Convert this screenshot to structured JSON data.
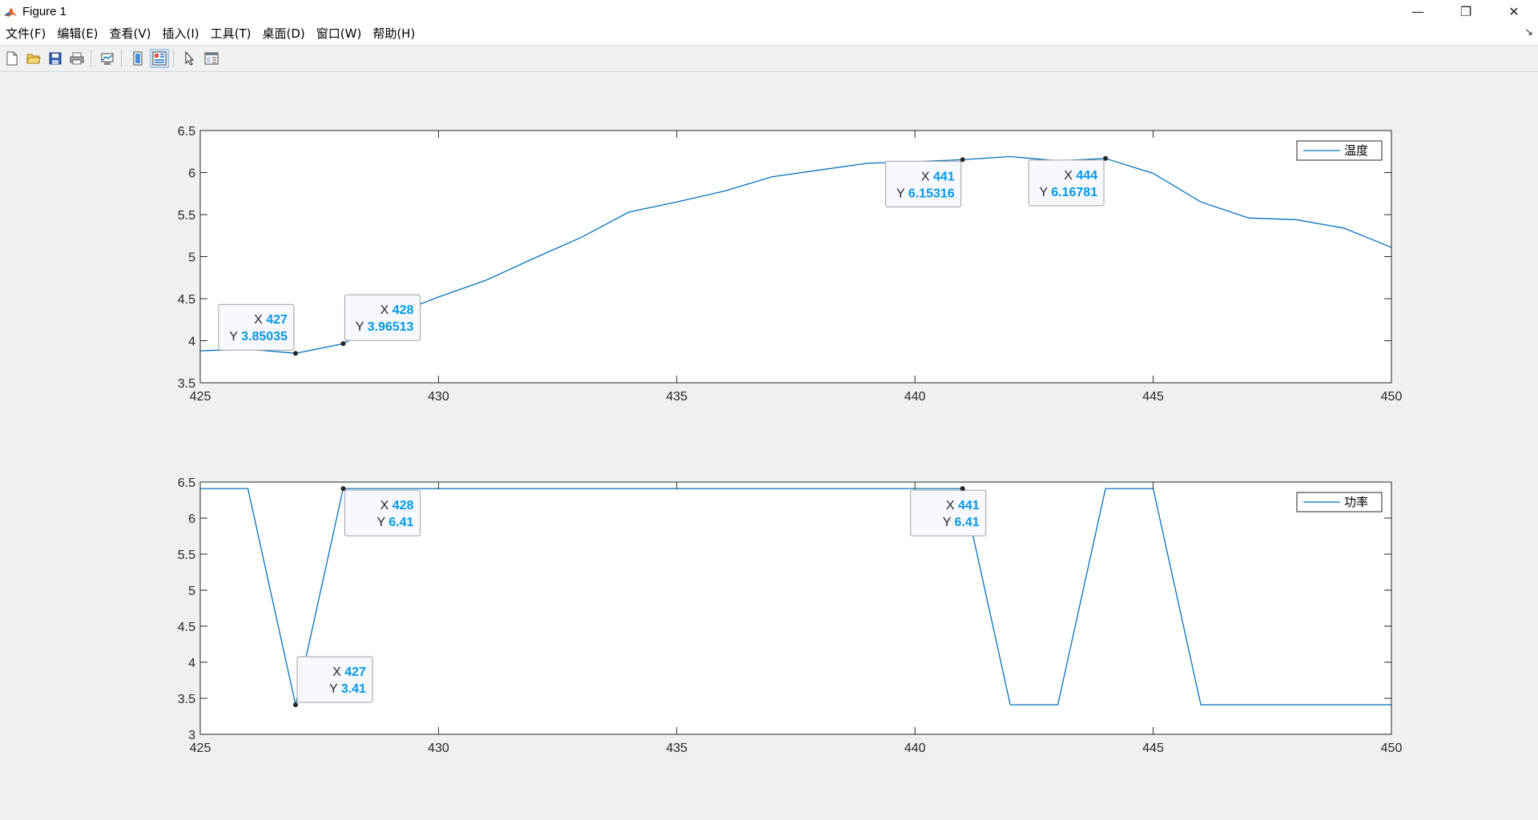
{
  "window": {
    "title": "Figure 1",
    "minimize_glyph": "—",
    "restore_glyph": "❐",
    "close_glyph": "✕"
  },
  "menu": {
    "items": [
      "文件(F)",
      "编辑(E)",
      "查看(V)",
      "插入(I)",
      "工具(T)",
      "桌面(D)",
      "窗口(W)",
      "帮助(H)"
    ],
    "dock_glyph": "↘"
  },
  "toolbar": {
    "icons": [
      "new-figure-icon",
      "open-file-icon",
      "save-icon",
      "print-icon",
      "link-plot-icon",
      "hide-plot-tools-icon",
      "show-plot-tools-icon",
      "edit-plot-pointer-icon",
      "property-inspector-icon"
    ]
  },
  "colors": {
    "line": "#0072bd",
    "datatip_value": "#0099e6",
    "axes_bg": "#ffffff",
    "figure_bg": "#f0f0f0"
  },
  "chart_data": [
    {
      "type": "line",
      "title": "",
      "xlabel": "",
      "ylabel": "",
      "xlim": [
        425,
        450
      ],
      "ylim": [
        3.5,
        6.5
      ],
      "xticks": [
        "425",
        "430",
        "435",
        "440",
        "445",
        "450"
      ],
      "yticks": [
        "3.5",
        "4",
        "4.5",
        "5",
        "5.5",
        "6",
        "6.5"
      ],
      "legend": {
        "position": "top-right",
        "entries": [
          "温度"
        ]
      },
      "series": [
        {
          "name": "温度",
          "x": [
            425,
            426,
            427,
            428,
            429,
            430,
            431,
            432,
            433,
            434,
            435,
            436,
            437,
            438,
            439,
            440,
            441,
            442,
            443,
            444,
            445,
            446,
            447,
            448,
            449,
            450
          ],
          "y": [
            3.88,
            3.9,
            3.85035,
            3.96513,
            4.3,
            4.52,
            4.72,
            4.98,
            5.23,
            5.53,
            5.65,
            5.78,
            5.95,
            6.03,
            6.11,
            6.13,
            6.15316,
            6.19,
            6.14,
            6.16781,
            5.99,
            5.65,
            5.46,
            5.44,
            5.34,
            5.11
          ]
        }
      ],
      "datatips": [
        {
          "x": 427,
          "y": 3.85035,
          "x_label": "X",
          "y_label": "Y",
          "x_text": "427",
          "y_text": "3.85035"
        },
        {
          "x": 428,
          "y": 3.96513,
          "x_label": "X",
          "y_label": "Y",
          "x_text": "428",
          "y_text": "3.96513"
        },
        {
          "x": 441,
          "y": 6.15316,
          "x_label": "X",
          "y_label": "Y",
          "x_text": "441",
          "y_text": "6.15316"
        },
        {
          "x": 444,
          "y": 6.16781,
          "x_label": "X",
          "y_label": "Y",
          "x_text": "444",
          "y_text": "6.16781"
        }
      ]
    },
    {
      "type": "line",
      "title": "",
      "xlabel": "",
      "ylabel": "",
      "xlim": [
        425,
        450
      ],
      "ylim": [
        3,
        6.5
      ],
      "xticks": [
        "425",
        "430",
        "435",
        "440",
        "445",
        "450"
      ],
      "yticks": [
        "3",
        "3.5",
        "4",
        "4.5",
        "5",
        "5.5",
        "6",
        "6.5"
      ],
      "legend": {
        "position": "top-right",
        "entries": [
          "功率"
        ]
      },
      "series": [
        {
          "name": "功率",
          "x": [
            425,
            426,
            427,
            428,
            429,
            430,
            431,
            432,
            433,
            434,
            435,
            436,
            437,
            438,
            439,
            440,
            441,
            442,
            443,
            444,
            445,
            446,
            447,
            448,
            449,
            450
          ],
          "y": [
            6.41,
            6.41,
            3.41,
            6.41,
            6.41,
            6.41,
            6.41,
            6.41,
            6.41,
            6.41,
            6.41,
            6.41,
            6.41,
            6.41,
            6.41,
            6.41,
            6.41,
            3.41,
            3.41,
            6.41,
            6.41,
            3.41,
            3.41,
            3.41,
            3.41,
            3.41
          ]
        }
      ],
      "datatips": [
        {
          "x": 427,
          "y": 3.41,
          "x_label": "X",
          "y_label": "Y",
          "x_text": "427",
          "y_text": "3.41"
        },
        {
          "x": 428,
          "y": 6.41,
          "x_label": "X",
          "y_label": "Y",
          "x_text": "428",
          "y_text": "6.41"
        },
        {
          "x": 441,
          "y": 6.41,
          "x_label": "X",
          "y_label": "Y",
          "x_text": "441",
          "y_text": "6.41"
        }
      ]
    }
  ]
}
